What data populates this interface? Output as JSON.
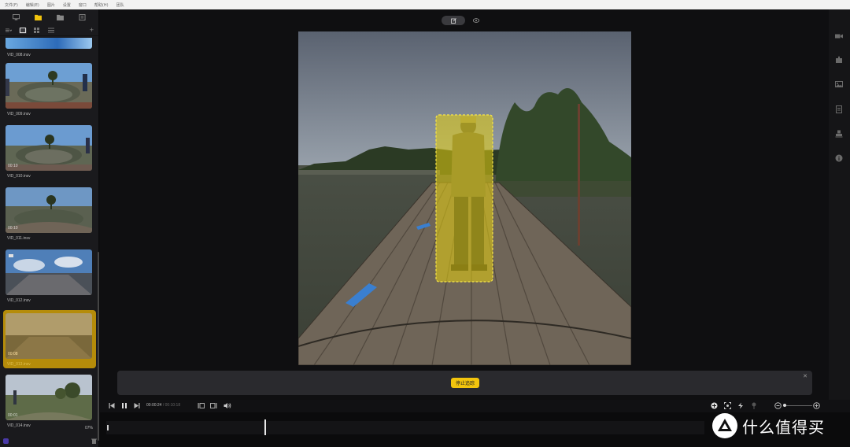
{
  "menubar": {
    "items": [
      "文件(F)",
      "编辑(E)",
      "图片",
      "设置",
      "窗口",
      "帮助(H)",
      "团队"
    ]
  },
  "library": {
    "first_clip_name": "VID_008.insv",
    "clips": [
      {
        "name": "VID_009.insv",
        "duration": "",
        "progress": "",
        "selected": false
      },
      {
        "name": "VID_010.insv",
        "duration": "00:10",
        "progress": "",
        "selected": false
      },
      {
        "name": "VID_011.insv",
        "duration": "00:10",
        "progress": "",
        "selected": false
      },
      {
        "name": "VID_012.insv",
        "duration": "",
        "progress": "",
        "selected": false
      },
      {
        "name": "VID_013.insv",
        "duration": "00:08",
        "progress": "",
        "selected": true
      },
      {
        "name": "VID_014.insv",
        "duration": "00:01",
        "progress": "07%",
        "selected": false
      }
    ]
  },
  "tracking": {
    "stop_label": "停止追踪",
    "accent": "#f2c40d"
  },
  "transport": {
    "current": "00:00:24",
    "total": " / 00:10:18"
  },
  "watermark": {
    "text": "什么值得买"
  },
  "colors": {
    "selection": "#b58c0a",
    "tracking_box": "#e7d20f"
  }
}
